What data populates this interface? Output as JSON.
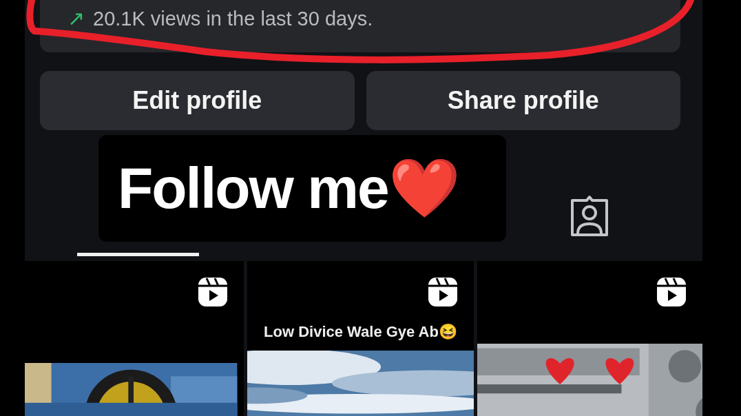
{
  "insights": {
    "arrow": "↗",
    "text": "20.1K views in the last 30 days."
  },
  "buttons": [
    "Edit profile",
    "Share profile"
  ],
  "sticker": {
    "text": "Follow me",
    "emoji": "❤️"
  },
  "tabs": [
    {
      "kind": "covered",
      "selected": true
    },
    {
      "kind": "tagged",
      "selected": false
    }
  ],
  "posts": [
    {
      "kind": "picture"
    },
    {
      "kind": "picture",
      "caption": "Low Divice Wale Gye Ab😆"
    },
    {
      "kind": "picture"
    }
  ]
}
